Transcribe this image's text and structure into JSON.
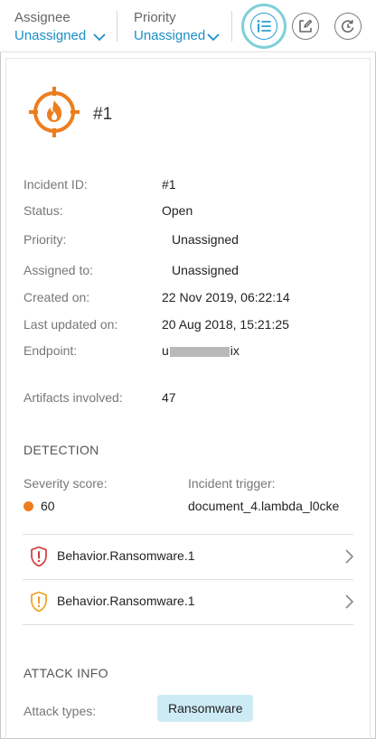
{
  "header": {
    "assignee_label": "Assignee",
    "assignee_value": "Unassigned",
    "priority_label": "Priority",
    "priority_value": "Unassigned"
  },
  "incident": {
    "title": "#1"
  },
  "details": [
    {
      "key": "Incident ID:",
      "value": "#1"
    },
    {
      "key": "Status:",
      "value": "Open"
    },
    {
      "key": "Priority:",
      "value": "Unassigned"
    },
    {
      "key": "Assigned to:",
      "value": "Unassigned"
    },
    {
      "key": "Created on:",
      "value": "22 Nov 2019, 06:22:14"
    },
    {
      "key": "Last updated on:",
      "value": "20 Aug 2018, 15:21:25"
    },
    {
      "key": "Endpoint:",
      "value_prefix": "u",
      "value_suffix": "ix"
    },
    {
      "key": "Artifacts involved:",
      "value": "47"
    }
  ],
  "detection": {
    "section_title": "DETECTION",
    "severity_label": "Severity score:",
    "severity_value": "60",
    "trigger_label": "Incident trigger:",
    "trigger_value": "document_4.lambda_l0cke",
    "behaviors": [
      {
        "label": "Behavior.Ransomware.1",
        "severity_color": "#d33a3a"
      },
      {
        "label": "Behavior.Ransomware.1",
        "severity_color": "#f0a11c"
      }
    ]
  },
  "attack": {
    "section_title": "ATTACK INFO",
    "types_label": "Attack types:",
    "types": [
      "Ransomware"
    ]
  },
  "colors": {
    "accent": "#1a8fc7",
    "incident_icon": "#ee7d1e",
    "halo": "#7fd0d8",
    "tag_bg": "#cdebf5"
  }
}
